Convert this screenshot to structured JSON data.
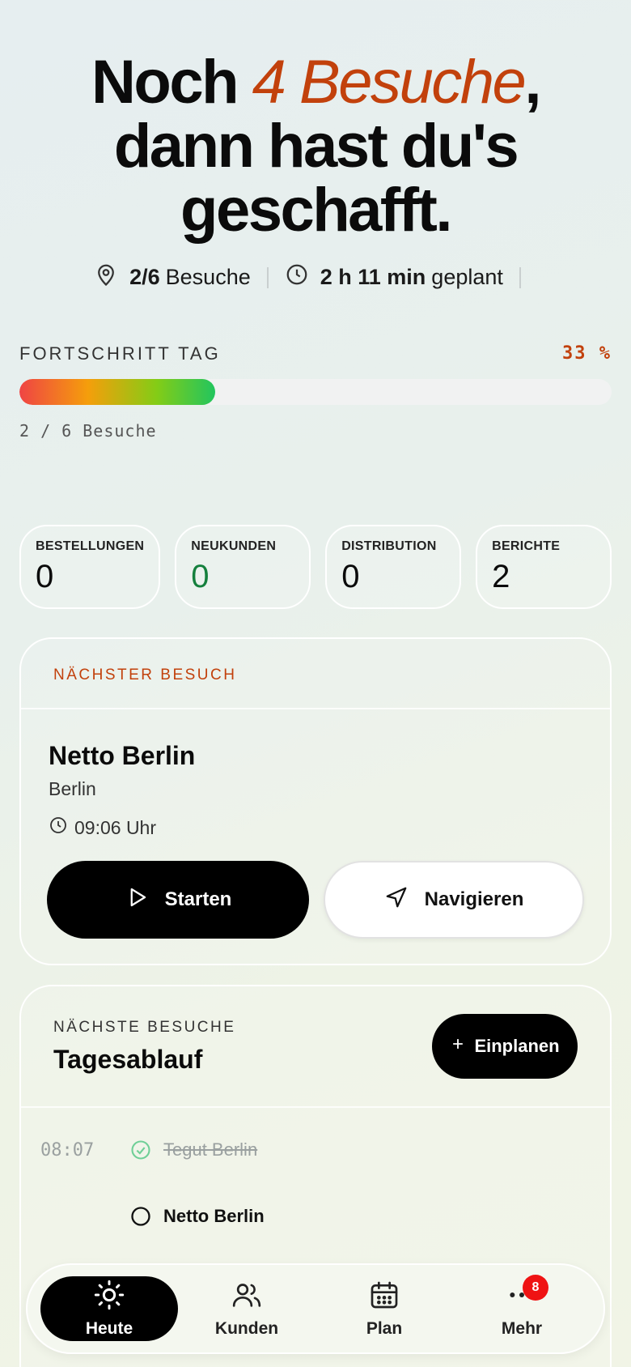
{
  "hero": {
    "line1_prefix": "Noch ",
    "line1_accent": "4 Besuche",
    "line1_suffix": ",",
    "line2": "dann hast du's",
    "line3": "geschafft."
  },
  "summary": {
    "visits_value": "2/6",
    "visits_label": "Besuche",
    "duration_value": "2 h 11 min",
    "duration_label": "geplant"
  },
  "progress": {
    "label": "FORTSCHRITT TAG",
    "percent_text": "33 %",
    "fraction": 0.33,
    "sub": "2 / 6 Besuche"
  },
  "stats": [
    {
      "label": "BESTELLUNGEN",
      "value": "0"
    },
    {
      "label": "NEUKUNDEN",
      "value": "0",
      "color": "#15803d"
    },
    {
      "label": "DISTRIBUTION",
      "value": "0"
    },
    {
      "label": "BERICHTE",
      "value": "2"
    }
  ],
  "next_visit": {
    "kicker": "NÄCHSTER BESUCH",
    "name": "Netto Berlin",
    "city": "Berlin",
    "time": "09:06 Uhr",
    "start_label": "Starten",
    "navigate_label": "Navigieren"
  },
  "plan": {
    "kicker": "NÄCHSTE BESUCHE",
    "title": "Tagesablauf",
    "add_label": "Einplanen",
    "rows": [
      {
        "time": "08:07",
        "name": "Tegut Berlin",
        "status": "done"
      },
      {
        "time": "",
        "name": "Netto Berlin",
        "status": "next"
      }
    ]
  },
  "tabs": [
    {
      "label": "Heute",
      "icon": "sun-icon",
      "active": true
    },
    {
      "label": "Kunden",
      "icon": "users-icon"
    },
    {
      "label": "Plan",
      "icon": "calendar-icon"
    },
    {
      "label": "Mehr",
      "icon": "more-icon",
      "badge": "8"
    }
  ],
  "colors": {
    "accent": "#c2410c",
    "positive": "#15803d",
    "badge": "#ef1313"
  }
}
